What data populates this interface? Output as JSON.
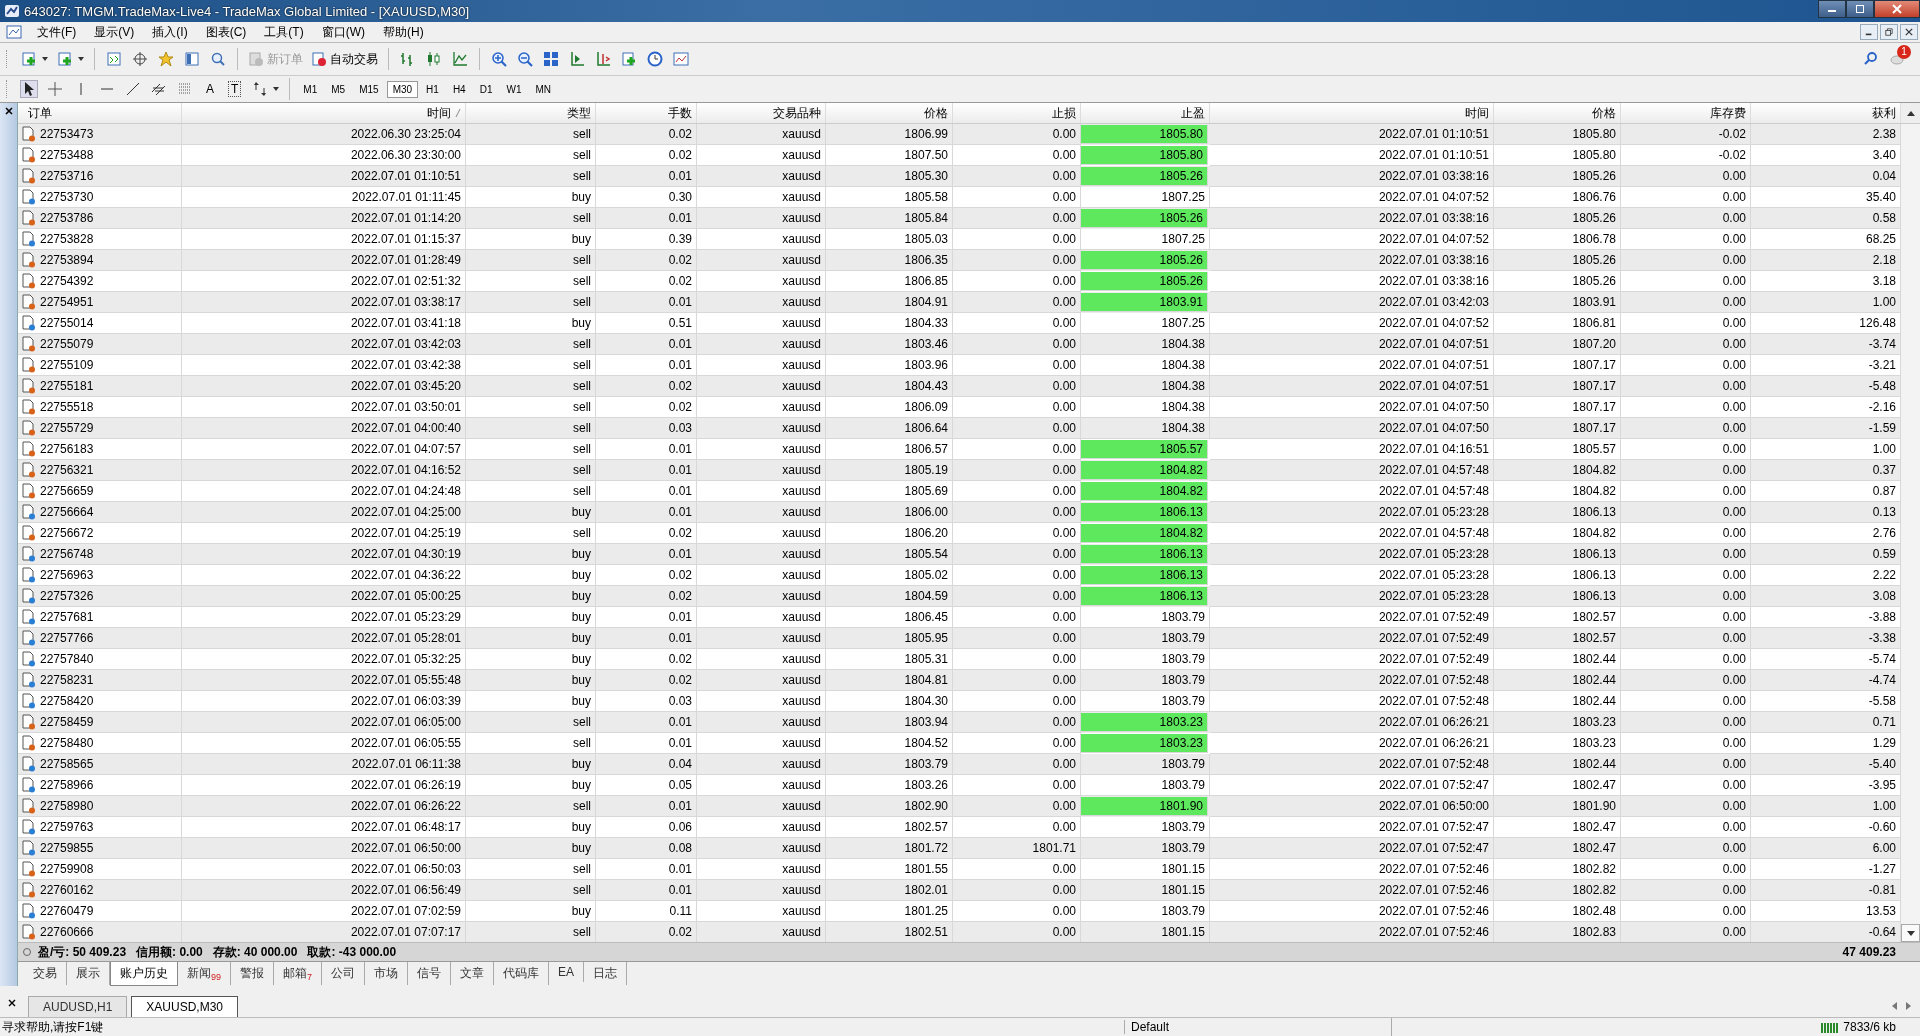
{
  "window": {
    "title": "643027: TMGM.TradeMax-Live4 - TradeMax Global Limited - [XAUUSD,M30]"
  },
  "menu": [
    "文件(F)",
    "显示(V)",
    "插入(I)",
    "图表(C)",
    "工具(T)",
    "窗口(W)",
    "帮助(H)"
  ],
  "toolbar_buttons": [
    {
      "label": "新订单",
      "disabled": true
    },
    {
      "label": "自动交易",
      "disabled": false
    }
  ],
  "notification_count": "1",
  "draw_text_tools": [
    "A",
    "T"
  ],
  "periods": [
    {
      "label": "M1",
      "selected": false
    },
    {
      "label": "M5",
      "selected": false
    },
    {
      "label": "M15",
      "selected": false
    },
    {
      "label": "M30",
      "selected": true
    },
    {
      "label": "H1",
      "selected": false
    },
    {
      "label": "H4",
      "selected": false
    },
    {
      "label": "D1",
      "selected": false
    },
    {
      "label": "W1",
      "selected": false
    },
    {
      "label": "MN",
      "selected": false
    }
  ],
  "table": {
    "columns": [
      {
        "label": "订单",
        "sorted": false
      },
      {
        "label": "时间",
        "sorted": true
      },
      {
        "label": "类型",
        "sorted": false
      },
      {
        "label": "手数",
        "sorted": false
      },
      {
        "label": "交易品种",
        "sorted": false
      },
      {
        "label": "价格",
        "sorted": false
      },
      {
        "label": "止损",
        "sorted": false
      },
      {
        "label": "止盈",
        "sorted": false
      },
      {
        "label": "时间",
        "sorted": false
      },
      {
        "label": "价格",
        "sorted": false
      },
      {
        "label": "库存费",
        "sorted": false
      },
      {
        "label": "获利",
        "sorted": false
      }
    ],
    "rows": [
      {
        "order": "22753473",
        "open_time": "2022.06.30 23:25:04",
        "kind": "sell",
        "type": "sell",
        "lots": "0.02",
        "symbol": "xauusd",
        "price": "1806.99",
        "sl": "0.00",
        "tp": "1805.80",
        "tp_hit": true,
        "close_time": "2022.07.01 01:10:51",
        "close_price": "1805.80",
        "swap": "-0.02",
        "profit": "2.38"
      },
      {
        "order": "22753488",
        "open_time": "2022.06.30 23:30:00",
        "kind": "sell",
        "type": "sell",
        "lots": "0.02",
        "symbol": "xauusd",
        "price": "1807.50",
        "sl": "0.00",
        "tp": "1805.80",
        "tp_hit": true,
        "close_time": "2022.07.01 01:10:51",
        "close_price": "1805.80",
        "swap": "-0.02",
        "profit": "3.40"
      },
      {
        "order": "22753716",
        "open_time": "2022.07.01 01:10:51",
        "kind": "sell",
        "type": "sell",
        "lots": "0.01",
        "symbol": "xauusd",
        "price": "1805.30",
        "sl": "0.00",
        "tp": "1805.26",
        "tp_hit": true,
        "close_time": "2022.07.01 03:38:16",
        "close_price": "1805.26",
        "swap": "0.00",
        "profit": "0.04"
      },
      {
        "order": "22753730",
        "open_time": "2022.07.01 01:11:45",
        "kind": "buy",
        "type": "buy",
        "lots": "0.30",
        "symbol": "xauusd",
        "price": "1805.58",
        "sl": "0.00",
        "tp": "1807.25",
        "tp_hit": false,
        "close_time": "2022.07.01 04:07:52",
        "close_price": "1806.76",
        "swap": "0.00",
        "profit": "35.40"
      },
      {
        "order": "22753786",
        "open_time": "2022.07.01 01:14:20",
        "kind": "sell",
        "type": "sell",
        "lots": "0.01",
        "symbol": "xauusd",
        "price": "1805.84",
        "sl": "0.00",
        "tp": "1805.26",
        "tp_hit": true,
        "close_time": "2022.07.01 03:38:16",
        "close_price": "1805.26",
        "swap": "0.00",
        "profit": "0.58"
      },
      {
        "order": "22753828",
        "open_time": "2022.07.01 01:15:37",
        "kind": "buy",
        "type": "buy",
        "lots": "0.39",
        "symbol": "xauusd",
        "price": "1805.03",
        "sl": "0.00",
        "tp": "1807.25",
        "tp_hit": false,
        "close_time": "2022.07.01 04:07:52",
        "close_price": "1806.78",
        "swap": "0.00",
        "profit": "68.25"
      },
      {
        "order": "22753894",
        "open_time": "2022.07.01 01:28:49",
        "kind": "sell",
        "type": "sell",
        "lots": "0.02",
        "symbol": "xauusd",
        "price": "1806.35",
        "sl": "0.00",
        "tp": "1805.26",
        "tp_hit": true,
        "close_time": "2022.07.01 03:38:16",
        "close_price": "1805.26",
        "swap": "0.00",
        "profit": "2.18"
      },
      {
        "order": "22754392",
        "open_time": "2022.07.01 02:51:32",
        "kind": "sell",
        "type": "sell",
        "lots": "0.02",
        "symbol": "xauusd",
        "price": "1806.85",
        "sl": "0.00",
        "tp": "1805.26",
        "tp_hit": true,
        "close_time": "2022.07.01 03:38:16",
        "close_price": "1805.26",
        "swap": "0.00",
        "profit": "3.18"
      },
      {
        "order": "22754951",
        "open_time": "2022.07.01 03:38:17",
        "kind": "sell",
        "type": "sell",
        "lots": "0.01",
        "symbol": "xauusd",
        "price": "1804.91",
        "sl": "0.00",
        "tp": "1803.91",
        "tp_hit": true,
        "close_time": "2022.07.01 03:42:03",
        "close_price": "1803.91",
        "swap": "0.00",
        "profit": "1.00"
      },
      {
        "order": "22755014",
        "open_time": "2022.07.01 03:41:18",
        "kind": "buy",
        "type": "buy",
        "lots": "0.51",
        "symbol": "xauusd",
        "price": "1804.33",
        "sl": "0.00",
        "tp": "1807.25",
        "tp_hit": false,
        "close_time": "2022.07.01 04:07:52",
        "close_price": "1806.81",
        "swap": "0.00",
        "profit": "126.48"
      },
      {
        "order": "22755079",
        "open_time": "2022.07.01 03:42:03",
        "kind": "sell",
        "type": "sell",
        "lots": "0.01",
        "symbol": "xauusd",
        "price": "1803.46",
        "sl": "0.00",
        "tp": "1804.38",
        "tp_hit": false,
        "close_time": "2022.07.01 04:07:51",
        "close_price": "1807.20",
        "swap": "0.00",
        "profit": "-3.74"
      },
      {
        "order": "22755109",
        "open_time": "2022.07.01 03:42:38",
        "kind": "sell",
        "type": "sell",
        "lots": "0.01",
        "symbol": "xauusd",
        "price": "1803.96",
        "sl": "0.00",
        "tp": "1804.38",
        "tp_hit": false,
        "close_time": "2022.07.01 04:07:51",
        "close_price": "1807.17",
        "swap": "0.00",
        "profit": "-3.21"
      },
      {
        "order": "22755181",
        "open_time": "2022.07.01 03:45:20",
        "kind": "sell",
        "type": "sell",
        "lots": "0.02",
        "symbol": "xauusd",
        "price": "1804.43",
        "sl": "0.00",
        "tp": "1804.38",
        "tp_hit": false,
        "close_time": "2022.07.01 04:07:51",
        "close_price": "1807.17",
        "swap": "0.00",
        "profit": "-5.48"
      },
      {
        "order": "22755518",
        "open_time": "2022.07.01 03:50:01",
        "kind": "sell",
        "type": "sell",
        "lots": "0.02",
        "symbol": "xauusd",
        "price": "1806.09",
        "sl": "0.00",
        "tp": "1804.38",
        "tp_hit": false,
        "close_time": "2022.07.01 04:07:50",
        "close_price": "1807.17",
        "swap": "0.00",
        "profit": "-2.16"
      },
      {
        "order": "22755729",
        "open_time": "2022.07.01 04:00:40",
        "kind": "sell",
        "type": "sell",
        "lots": "0.03",
        "symbol": "xauusd",
        "price": "1806.64",
        "sl": "0.00",
        "tp": "1804.38",
        "tp_hit": false,
        "close_time": "2022.07.01 04:07:50",
        "close_price": "1807.17",
        "swap": "0.00",
        "profit": "-1.59"
      },
      {
        "order": "22756183",
        "open_time": "2022.07.01 04:07:57",
        "kind": "sell",
        "type": "sell",
        "lots": "0.01",
        "symbol": "xauusd",
        "price": "1806.57",
        "sl": "0.00",
        "tp": "1805.57",
        "tp_hit": true,
        "close_time": "2022.07.01 04:16:51",
        "close_price": "1805.57",
        "swap": "0.00",
        "profit": "1.00"
      },
      {
        "order": "22756321",
        "open_time": "2022.07.01 04:16:52",
        "kind": "sell",
        "type": "sell",
        "lots": "0.01",
        "symbol": "xauusd",
        "price": "1805.19",
        "sl": "0.00",
        "tp": "1804.82",
        "tp_hit": true,
        "close_time": "2022.07.01 04:57:48",
        "close_price": "1804.82",
        "swap": "0.00",
        "profit": "0.37"
      },
      {
        "order": "22756659",
        "open_time": "2022.07.01 04:24:48",
        "kind": "sell",
        "type": "sell",
        "lots": "0.01",
        "symbol": "xauusd",
        "price": "1805.69",
        "sl": "0.00",
        "tp": "1804.82",
        "tp_hit": true,
        "close_time": "2022.07.01 04:57:48",
        "close_price": "1804.82",
        "swap": "0.00",
        "profit": "0.87"
      },
      {
        "order": "22756664",
        "open_time": "2022.07.01 04:25:00",
        "kind": "buy",
        "type": "buy",
        "lots": "0.01",
        "symbol": "xauusd",
        "price": "1806.00",
        "sl": "0.00",
        "tp": "1806.13",
        "tp_hit": true,
        "close_time": "2022.07.01 05:23:28",
        "close_price": "1806.13",
        "swap": "0.00",
        "profit": "0.13"
      },
      {
        "order": "22756672",
        "open_time": "2022.07.01 04:25:19",
        "kind": "sell",
        "type": "sell",
        "lots": "0.02",
        "symbol": "xauusd",
        "price": "1806.20",
        "sl": "0.00",
        "tp": "1804.82",
        "tp_hit": true,
        "close_time": "2022.07.01 04:57:48",
        "close_price": "1804.82",
        "swap": "0.00",
        "profit": "2.76"
      },
      {
        "order": "22756748",
        "open_time": "2022.07.01 04:30:19",
        "kind": "buy",
        "type": "buy",
        "lots": "0.01",
        "symbol": "xauusd",
        "price": "1805.54",
        "sl": "0.00",
        "tp": "1806.13",
        "tp_hit": true,
        "close_time": "2022.07.01 05:23:28",
        "close_price": "1806.13",
        "swap": "0.00",
        "profit": "0.59"
      },
      {
        "order": "22756963",
        "open_time": "2022.07.01 04:36:22",
        "kind": "buy",
        "type": "buy",
        "lots": "0.02",
        "symbol": "xauusd",
        "price": "1805.02",
        "sl": "0.00",
        "tp": "1806.13",
        "tp_hit": true,
        "close_time": "2022.07.01 05:23:28",
        "close_price": "1806.13",
        "swap": "0.00",
        "profit": "2.22"
      },
      {
        "order": "22757326",
        "open_time": "2022.07.01 05:00:25",
        "kind": "buy",
        "type": "buy",
        "lots": "0.02",
        "symbol": "xauusd",
        "price": "1804.59",
        "sl": "0.00",
        "tp": "1806.13",
        "tp_hit": true,
        "close_time": "2022.07.01 05:23:28",
        "close_price": "1806.13",
        "swap": "0.00",
        "profit": "3.08"
      },
      {
        "order": "22757681",
        "open_time": "2022.07.01 05:23:29",
        "kind": "buy",
        "type": "buy",
        "lots": "0.01",
        "symbol": "xauusd",
        "price": "1806.45",
        "sl": "0.00",
        "tp": "1803.79",
        "tp_hit": false,
        "close_time": "2022.07.01 07:52:49",
        "close_price": "1802.57",
        "swap": "0.00",
        "profit": "-3.88"
      },
      {
        "order": "22757766",
        "open_time": "2022.07.01 05:28:01",
        "kind": "buy",
        "type": "buy",
        "lots": "0.01",
        "symbol": "xauusd",
        "price": "1805.95",
        "sl": "0.00",
        "tp": "1803.79",
        "tp_hit": false,
        "close_time": "2022.07.01 07:52:49",
        "close_price": "1802.57",
        "swap": "0.00",
        "profit": "-3.38"
      },
      {
        "order": "22757840",
        "open_time": "2022.07.01 05:32:25",
        "kind": "buy",
        "type": "buy",
        "lots": "0.02",
        "symbol": "xauusd",
        "price": "1805.31",
        "sl": "0.00",
        "tp": "1803.79",
        "tp_hit": false,
        "close_time": "2022.07.01 07:52:49",
        "close_price": "1802.44",
        "swap": "0.00",
        "profit": "-5.74"
      },
      {
        "order": "22758231",
        "open_time": "2022.07.01 05:55:48",
        "kind": "buy",
        "type": "buy",
        "lots": "0.02",
        "symbol": "xauusd",
        "price": "1804.81",
        "sl": "0.00",
        "tp": "1803.79",
        "tp_hit": false,
        "close_time": "2022.07.01 07:52:48",
        "close_price": "1802.44",
        "swap": "0.00",
        "profit": "-4.74"
      },
      {
        "order": "22758420",
        "open_time": "2022.07.01 06:03:39",
        "kind": "buy",
        "type": "buy",
        "lots": "0.03",
        "symbol": "xauusd",
        "price": "1804.30",
        "sl": "0.00",
        "tp": "1803.79",
        "tp_hit": false,
        "close_time": "2022.07.01 07:52:48",
        "close_price": "1802.44",
        "swap": "0.00",
        "profit": "-5.58"
      },
      {
        "order": "22758459",
        "open_time": "2022.07.01 06:05:00",
        "kind": "sell",
        "type": "sell",
        "lots": "0.01",
        "symbol": "xauusd",
        "price": "1803.94",
        "sl": "0.00",
        "tp": "1803.23",
        "tp_hit": true,
        "close_time": "2022.07.01 06:26:21",
        "close_price": "1803.23",
        "swap": "0.00",
        "profit": "0.71"
      },
      {
        "order": "22758480",
        "open_time": "2022.07.01 06:05:55",
        "kind": "sell",
        "type": "sell",
        "lots": "0.01",
        "symbol": "xauusd",
        "price": "1804.52",
        "sl": "0.00",
        "tp": "1803.23",
        "tp_hit": true,
        "close_time": "2022.07.01 06:26:21",
        "close_price": "1803.23",
        "swap": "0.00",
        "profit": "1.29"
      },
      {
        "order": "22758565",
        "open_time": "2022.07.01 06:11:38",
        "kind": "buy",
        "type": "buy",
        "lots": "0.04",
        "symbol": "xauusd",
        "price": "1803.79",
        "sl": "0.00",
        "tp": "1803.79",
        "tp_hit": false,
        "close_time": "2022.07.01 07:52:48",
        "close_price": "1802.44",
        "swap": "0.00",
        "profit": "-5.40"
      },
      {
        "order": "22758966",
        "open_time": "2022.07.01 06:26:19",
        "kind": "buy",
        "type": "buy",
        "lots": "0.05",
        "symbol": "xauusd",
        "price": "1803.26",
        "sl": "0.00",
        "tp": "1803.79",
        "tp_hit": false,
        "close_time": "2022.07.01 07:52:47",
        "close_price": "1802.47",
        "swap": "0.00",
        "profit": "-3.95"
      },
      {
        "order": "22758980",
        "open_time": "2022.07.01 06:26:22",
        "kind": "sell",
        "type": "sell",
        "lots": "0.01",
        "symbol": "xauusd",
        "price": "1802.90",
        "sl": "0.00",
        "tp": "1801.90",
        "tp_hit": true,
        "close_time": "2022.07.01 06:50:00",
        "close_price": "1801.90",
        "swap": "0.00",
        "profit": "1.00"
      },
      {
        "order": "22759763",
        "open_time": "2022.07.01 06:48:17",
        "kind": "buy",
        "type": "buy",
        "lots": "0.06",
        "symbol": "xauusd",
        "price": "1802.57",
        "sl": "0.00",
        "tp": "1803.79",
        "tp_hit": false,
        "close_time": "2022.07.01 07:52:47",
        "close_price": "1802.47",
        "swap": "0.00",
        "profit": "-0.60"
      },
      {
        "order": "22759855",
        "open_time": "2022.07.01 06:50:00",
        "kind": "buy",
        "type": "buy",
        "lots": "0.08",
        "symbol": "xauusd",
        "price": "1801.72",
        "sl": "1801.71",
        "tp": "1803.79",
        "tp_hit": false,
        "close_time": "2022.07.01 07:52:47",
        "close_price": "1802.47",
        "swap": "0.00",
        "profit": "6.00"
      },
      {
        "order": "22759908",
        "open_time": "2022.07.01 06:50:03",
        "kind": "sell",
        "type": "sell",
        "lots": "0.01",
        "symbol": "xauusd",
        "price": "1801.55",
        "sl": "0.00",
        "tp": "1801.15",
        "tp_hit": false,
        "close_time": "2022.07.01 07:52:46",
        "close_price": "1802.82",
        "swap": "0.00",
        "profit": "-1.27"
      },
      {
        "order": "22760162",
        "open_time": "2022.07.01 06:56:49",
        "kind": "sell",
        "type": "sell",
        "lots": "0.01",
        "symbol": "xauusd",
        "price": "1802.01",
        "sl": "0.00",
        "tp": "1801.15",
        "tp_hit": false,
        "close_time": "2022.07.01 07:52:46",
        "close_price": "1802.82",
        "swap": "0.00",
        "profit": "-0.81"
      },
      {
        "order": "22760479",
        "open_time": "2022.07.01 07:02:59",
        "kind": "buy",
        "type": "buy",
        "lots": "0.11",
        "symbol": "xauusd",
        "price": "1801.25",
        "sl": "0.00",
        "tp": "1803.79",
        "tp_hit": false,
        "close_time": "2022.07.01 07:52:46",
        "close_price": "1802.48",
        "swap": "0.00",
        "profit": "13.53"
      },
      {
        "order": "22760666",
        "open_time": "2022.07.01 07:07:17",
        "kind": "sell",
        "type": "sell",
        "lots": "0.02",
        "symbol": "xauusd",
        "price": "1802.51",
        "sl": "0.00",
        "tp": "1801.15",
        "tp_hit": false,
        "close_time": "2022.07.01 07:52:46",
        "close_price": "1802.83",
        "swap": "0.00",
        "profit": "-0.64"
      }
    ]
  },
  "summary": {
    "items": [
      "盈/亏: 50 409.23",
      "信用额: 0.00",
      "存款: 40 000.00",
      "取款: -43 000.00"
    ],
    "total": "47 409.23"
  },
  "terminal_tabs": [
    {
      "label": "交易",
      "selected": false
    },
    {
      "label": "展示",
      "selected": false
    },
    {
      "label": "账户历史",
      "selected": true
    },
    {
      "label": "新闻",
      "badge": "99",
      "selected": false
    },
    {
      "label": "警报",
      "selected": false
    },
    {
      "label": "邮箱",
      "badge": "7",
      "selected": false
    },
    {
      "label": "公司",
      "selected": false
    },
    {
      "label": "市场",
      "selected": false
    },
    {
      "label": "信号",
      "selected": false
    },
    {
      "label": "文章",
      "selected": false
    },
    {
      "label": "代码库",
      "selected": false
    },
    {
      "label": "EA",
      "selected": false
    },
    {
      "label": "日志",
      "selected": false
    }
  ],
  "chart_tabs": [
    {
      "label": "AUDUSD,H1",
      "selected": false
    },
    {
      "label": "XAUUSD,M30",
      "selected": true
    }
  ],
  "status_bar": {
    "help": "寻求帮助,请按F1键",
    "profile": "Default",
    "traffic": "7833/6 kb"
  }
}
